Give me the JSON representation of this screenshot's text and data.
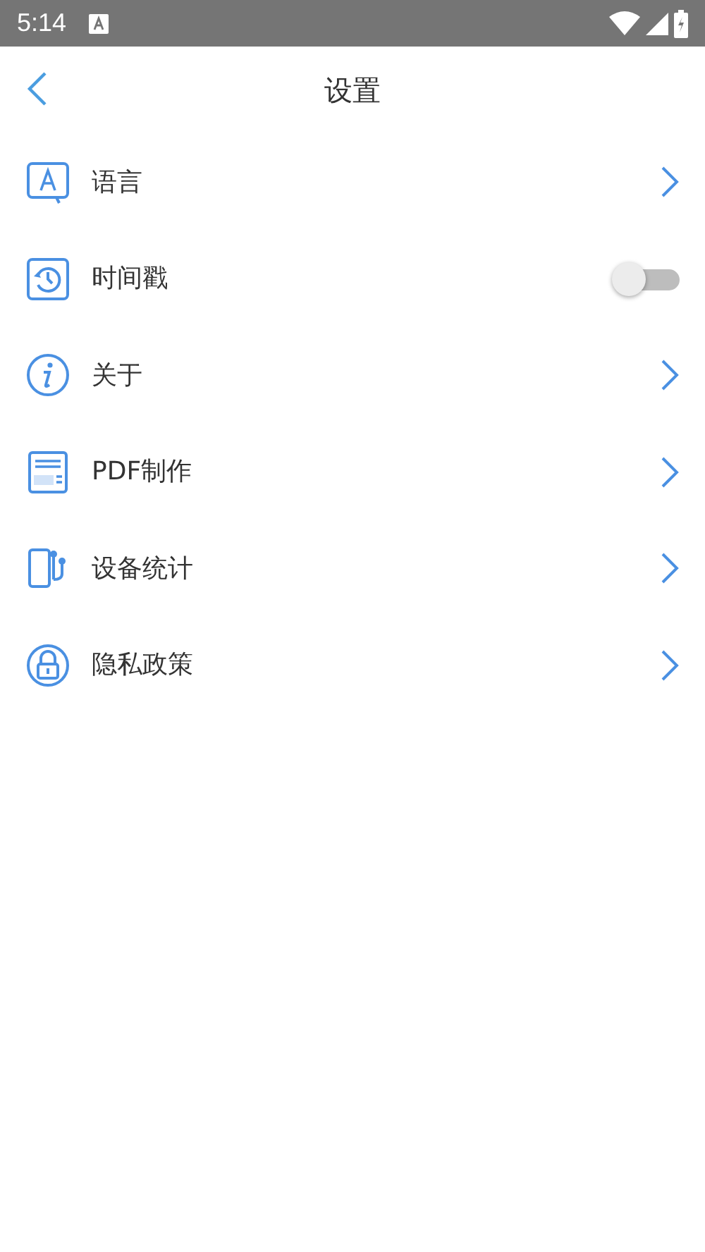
{
  "status_bar": {
    "time": "5:14"
  },
  "header": {
    "title": "设置"
  },
  "items": [
    {
      "kind": "link",
      "label": "语言"
    },
    {
      "kind": "toggle",
      "label": "时间戳",
      "on": false
    },
    {
      "kind": "link",
      "label": "关于"
    },
    {
      "kind": "link",
      "label": "PDF制作"
    },
    {
      "kind": "link",
      "label": "设备统计"
    },
    {
      "kind": "link",
      "label": "隐私政策"
    }
  ]
}
